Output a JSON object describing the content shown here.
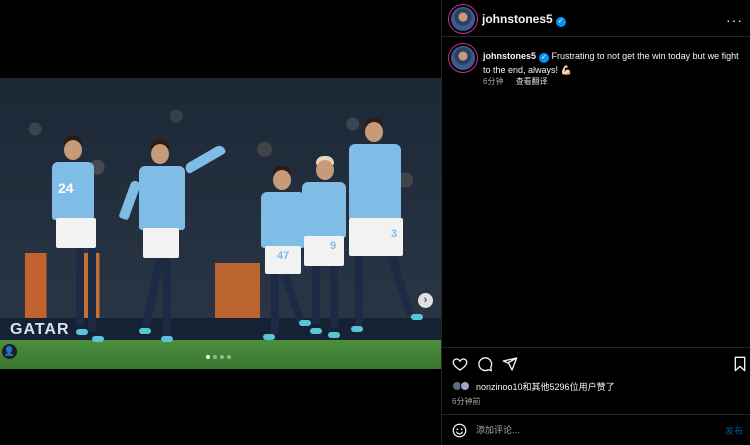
{
  "post": {
    "username": "johnstones5",
    "caption_text": "Frustrating to not get the win today but we fight to the end, always! 💪🏻",
    "caption_time": "6分钟",
    "translate_label": "查看翻译",
    "more_label": "···"
  },
  "media": {
    "ad_board_text": "GATAR",
    "jersey_numbers": [
      "24",
      "47",
      "9",
      "3"
    ],
    "carousel_dots": 4,
    "active_dot_index": 0,
    "next_icon": "chevron-right-icon",
    "user_tag_icon": "user-icon"
  },
  "engagement": {
    "likes_text": "nonzinoo10和其他5296位用户赞了",
    "time_ago": "6分钟前"
  },
  "comment": {
    "placeholder": "添加评论...",
    "post_label": "发布"
  },
  "icons": {
    "like": "heart-icon",
    "comment": "comment-icon",
    "share": "send-icon",
    "save": "bookmark-icon",
    "emoji": "emoji-icon",
    "verified": "verified-badge-icon"
  },
  "colors": {
    "background": "#000000",
    "verified": "#0095f6",
    "link": "#0095f6",
    "muted_text": "#a8a8a8",
    "kit": "#7fbde6"
  }
}
